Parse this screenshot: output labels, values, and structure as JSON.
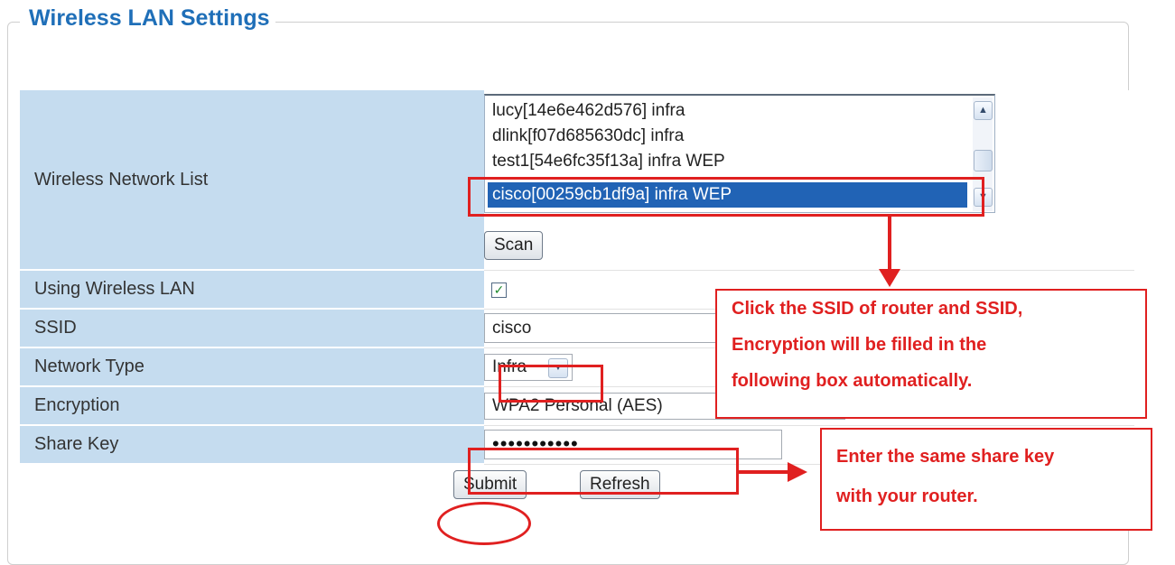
{
  "page": {
    "legend_title": "Wireless LAN Settings"
  },
  "form": {
    "wireless_network_list_label": "Wireless Network List",
    "networks": [
      "lucy[14e6e462d576] infra",
      "dlink[f07d685630dc] infra",
      "test1[54e6fc35f13a] infra WEP",
      "cisco[00259cb1df9a] infra WEP"
    ],
    "selected_network": "cisco[00259cb1df9a] infra WEP",
    "scan_label": "Scan",
    "using_wireless_lan_label": "Using Wireless LAN",
    "using_wireless_lan_checked": true,
    "ssid_label": "SSID",
    "ssid_value": "cisco",
    "network_type_label": "Network Type",
    "network_type_value": "Infra",
    "encryption_label": "Encryption",
    "encryption_value": "WPA2 Personal (AES)",
    "share_key_label": "Share Key",
    "share_key_value": "•••••••••••",
    "submit_label": "Submit",
    "refresh_label": "Refresh"
  },
  "annotations": {
    "callout_ssid": [
      "Click the SSID of router and SSID,",
      "Encryption will be filled in the",
      "following box automatically."
    ],
    "callout_key": [
      "Enter the same share key",
      "with your router."
    ],
    "highlight_color": "#e02020"
  },
  "icons": {
    "scroll_up": "chevron-up-icon",
    "scroll_down": "chevron-down-icon",
    "dropdown": "chevron-down-icon",
    "checkmark": "check-icon"
  }
}
